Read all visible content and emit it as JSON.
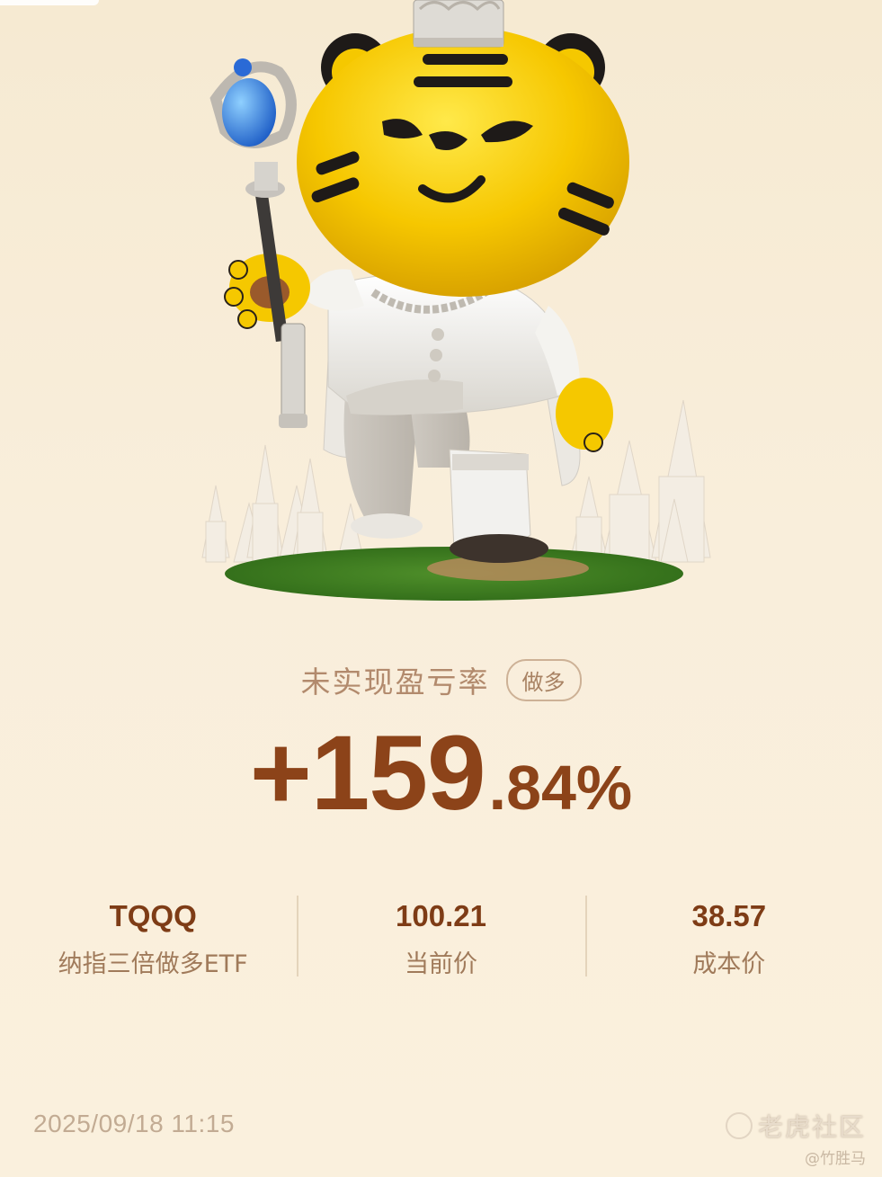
{
  "headline": {
    "label": "未实现盈亏率",
    "badge": "做多"
  },
  "pnl": {
    "integer_part": "+159",
    "dot": ".",
    "decimal_part": "84%"
  },
  "stats": [
    {
      "value": "TQQQ",
      "label": "纳指三倍做多ETF"
    },
    {
      "value": "100.21",
      "label": "当前价"
    },
    {
      "value": "38.57",
      "label": "成本价"
    }
  ],
  "timestamp": "2025/09/18 11:15",
  "watermark": {
    "title": "老虎社区",
    "author": "@竹胜马"
  },
  "colors": {
    "background": "#f9eed6",
    "pnl_text": "#8c4319",
    "label_text": "#b28a6d",
    "divider": "#e4d4bb",
    "tiger_yellow": "#f5c800"
  },
  "illustration": {
    "subject": "tiger-king-mascot",
    "items": [
      "crown",
      "scepter",
      "white-suit",
      "cape",
      "castle-towers",
      "grass-patch"
    ]
  }
}
